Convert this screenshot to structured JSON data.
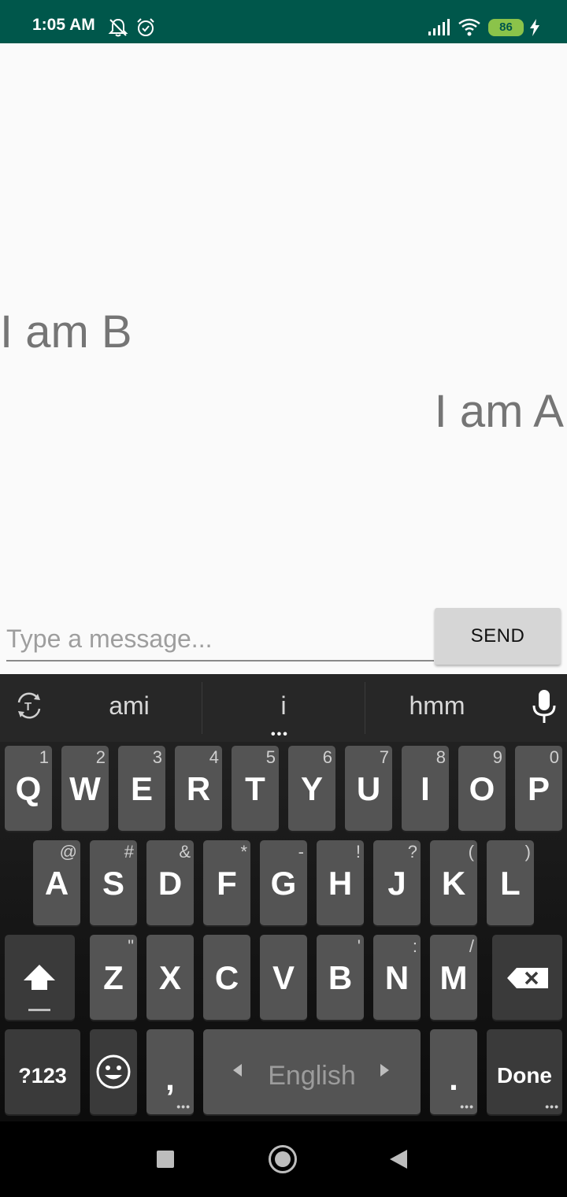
{
  "status_bar": {
    "time": "1:05 AM",
    "battery": "86"
  },
  "chat": {
    "messages": [
      {
        "text": "I am B"
      },
      {
        "text": "I am A"
      }
    ]
  },
  "input": {
    "placeholder": "Type a message...",
    "value": "",
    "send_label": "SEND"
  },
  "keyboard": {
    "suggestions": [
      "ami",
      "i",
      "hmm"
    ],
    "row1": [
      {
        "key": "Q",
        "hint": "1"
      },
      {
        "key": "W",
        "hint": "2"
      },
      {
        "key": "E",
        "hint": "3"
      },
      {
        "key": "R",
        "hint": "4"
      },
      {
        "key": "T",
        "hint": "5"
      },
      {
        "key": "Y",
        "hint": "6"
      },
      {
        "key": "U",
        "hint": "7"
      },
      {
        "key": "I",
        "hint": "8"
      },
      {
        "key": "O",
        "hint": "9"
      },
      {
        "key": "P",
        "hint": "0"
      }
    ],
    "row2": [
      {
        "key": "A",
        "hint": "@"
      },
      {
        "key": "S",
        "hint": "#"
      },
      {
        "key": "D",
        "hint": "&"
      },
      {
        "key": "F",
        "hint": "*"
      },
      {
        "key": "G",
        "hint": "-"
      },
      {
        "key": "H",
        "hint": "!"
      },
      {
        "key": "J",
        "hint": "?"
      },
      {
        "key": "K",
        "hint": "("
      },
      {
        "key": "L",
        "hint": ")"
      }
    ],
    "row3": [
      {
        "key": "Z",
        "hint": "\""
      },
      {
        "key": "X",
        "hint": ""
      },
      {
        "key": "C",
        "hint": ""
      },
      {
        "key": "V",
        "hint": ""
      },
      {
        "key": "B",
        "hint": "'"
      },
      {
        "key": "N",
        "hint": ":"
      },
      {
        "key": "M",
        "hint": "/"
      }
    ],
    "symbols_label": "?123",
    "comma_label": ",",
    "space_label": "English",
    "period_label": ".",
    "done_label": "Done"
  },
  "colors": {
    "status_bar": "#00574b",
    "battery": "#8bc34a",
    "key": "#545454",
    "key_dark": "#3a3a3a"
  }
}
